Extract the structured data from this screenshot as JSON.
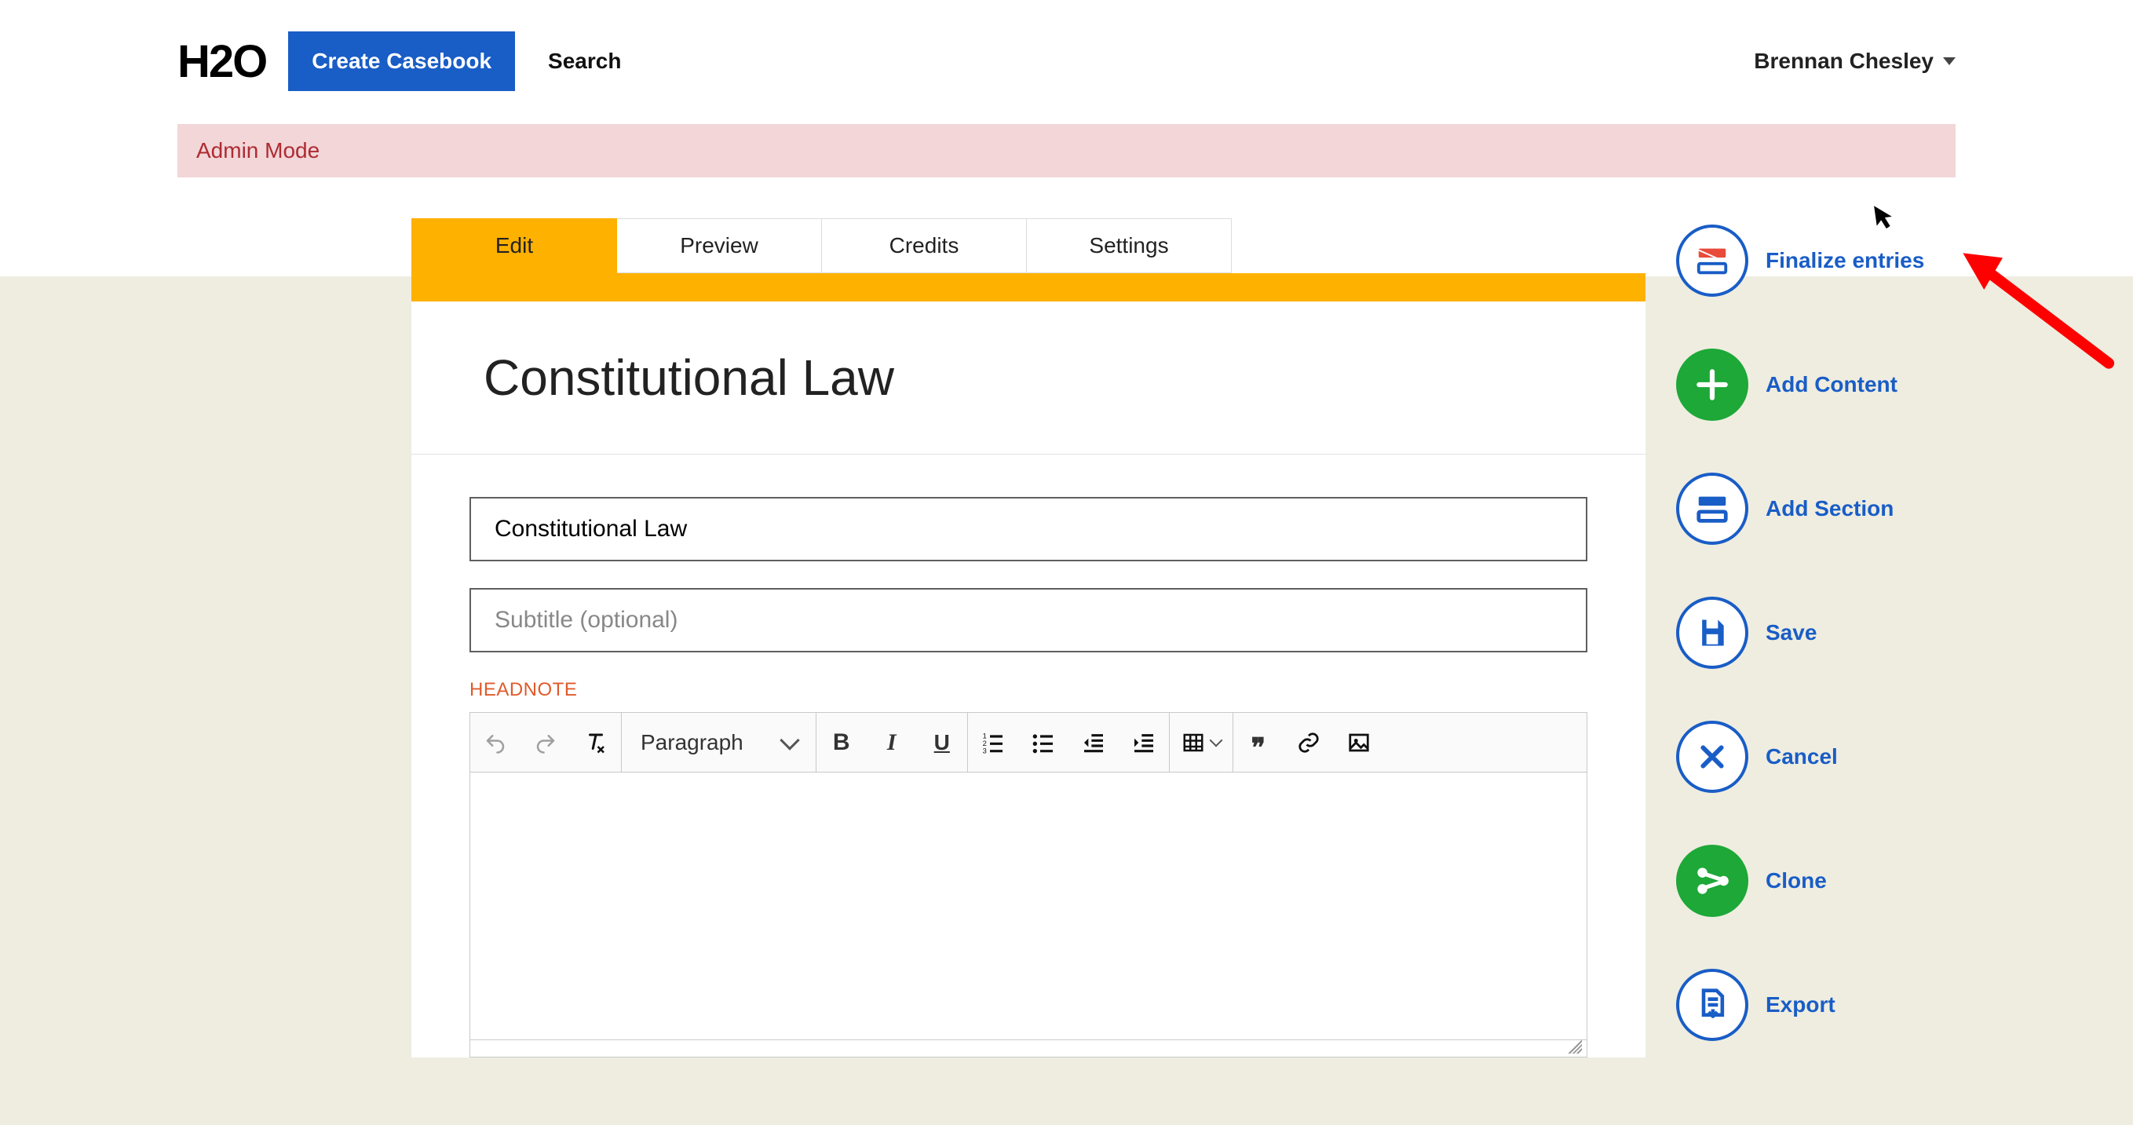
{
  "header": {
    "logo": "H2O",
    "create_label": "Create Casebook",
    "search_label": "Search",
    "user_name": "Brennan Chesley"
  },
  "admin_banner": "Admin Mode",
  "tabs": [
    "Edit",
    "Preview",
    "Credits",
    "Settings"
  ],
  "active_tab_index": 0,
  "page_title": "Constitutional Law",
  "form": {
    "title_value": "Constitutional Law",
    "subtitle_placeholder": "Subtitle (optional)",
    "subtitle_value": "",
    "headnote_label": "HEADNOTE"
  },
  "rte": {
    "block_format": "Paragraph"
  },
  "actions": {
    "finalize": "Finalize entries",
    "add_content": "Add Content",
    "add_section": "Add Section",
    "save": "Save",
    "cancel": "Cancel",
    "clone": "Clone",
    "export": "Export"
  }
}
